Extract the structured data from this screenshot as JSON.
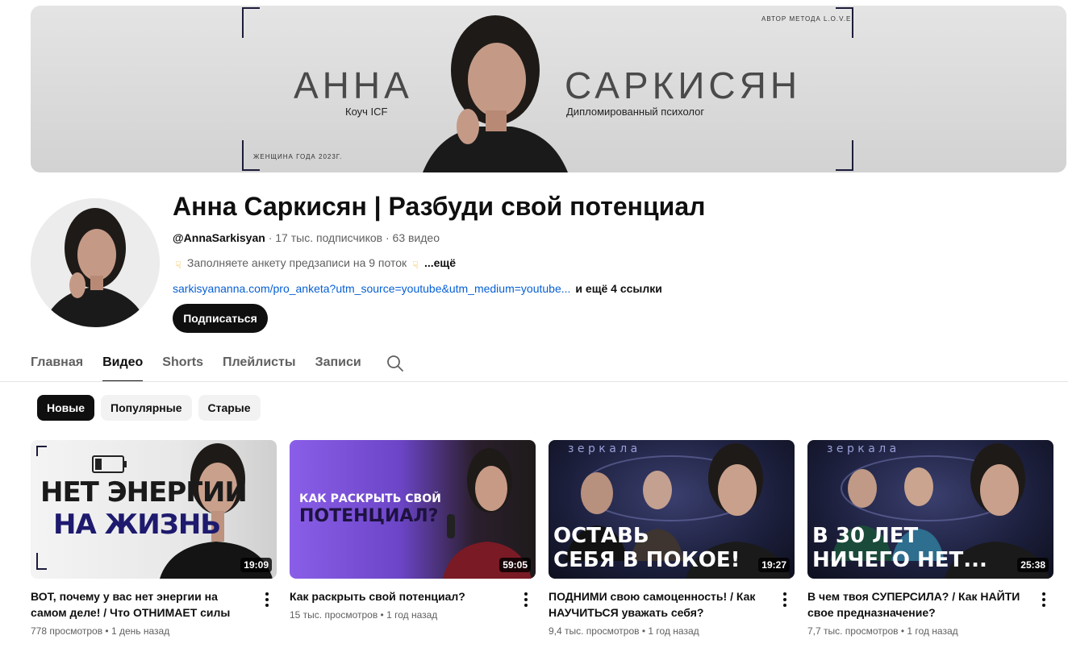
{
  "banner": {
    "first_name": "АННА",
    "last_name": "САРКИСЯН",
    "subtitle_left": "Коуч ICF",
    "subtitle_right": "Дипломированный психолог",
    "top_right": "АВТОР МЕТОДА L.O.V.E",
    "bottom_left": "ЖЕНЩИНА ГОДА 2023Г."
  },
  "channel": {
    "name": "Анна Саркисян | Разбуди свой потенциал",
    "handle": "@AnnaSarkisyan",
    "subscribers": "17 тыс. подписчиков",
    "videos_count": "63 видео",
    "sep": " · ",
    "description": "Заполняете анкету предзаписи на 9 поток",
    "description_more": "...ещё",
    "link": "sarkisyananna.com/pro_anketa?utm_source=youtube&utm_medium=youtube...",
    "more_links": "и ещё 4 ссылки",
    "subscribe_label": "Подписаться"
  },
  "tabs": [
    {
      "label": "Главная"
    },
    {
      "label": "Видео"
    },
    {
      "label": "Shorts"
    },
    {
      "label": "Плейлисты"
    },
    {
      "label": "Записи"
    }
  ],
  "chips": [
    {
      "label": "Новые"
    },
    {
      "label": "Популярные"
    },
    {
      "label": "Старые"
    }
  ],
  "videos": [
    {
      "title": "ВОТ, почему у вас нет энергии на самом деле! / Что ОТНИМАЕТ силы каждый...",
      "views": "778 просмотров",
      "age": "1 день назад",
      "duration": "19:09",
      "thumb_line1": "НЕТ ЭНЕРГИИ",
      "thumb_line2": "НА ЖИЗНЬ"
    },
    {
      "title": "Как раскрыть свой потенциал?",
      "views": "15 тыс. просмотров",
      "age": "1 год назад",
      "duration": "59:05",
      "thumb_line1": "КАК РАСКРЫТЬ СВОЙ",
      "thumb_line2": "ПОТЕНЦИАЛ?"
    },
    {
      "title": "ПОДНИМИ свою самоценность! / Как НАУЧИТЬСЯ уважать себя?",
      "views": "9,4 тыс. просмотров",
      "age": "1 год назад",
      "duration": "19:27",
      "thumb_top": "з е р к а л а",
      "thumb_line1": "ОСТАВЬ",
      "thumb_line2": "СЕБЯ В ПОКОЕ!"
    },
    {
      "title": "В чем твоя СУПЕРСИЛА? / Как НАЙТИ свое предназначение?",
      "views": "7,7 тыс. просмотров",
      "age": "1 год назад",
      "duration": "25:38",
      "thumb_top": "з е р к а л а",
      "thumb_line1": "В 30 ЛЕТ",
      "thumb_line2": "НИЧЕГО НЕТ..."
    }
  ],
  "icons": {
    "tab_search": "search-icon",
    "kebab": "more-vert-icon",
    "battery": "battery-low-icon",
    "emoji": "pointing-down-icon"
  },
  "colors": {
    "link": "#065fd4",
    "primary_text": "#0f0f0f",
    "secondary_text": "#606060",
    "chip_bg": "#f2f2f2"
  }
}
